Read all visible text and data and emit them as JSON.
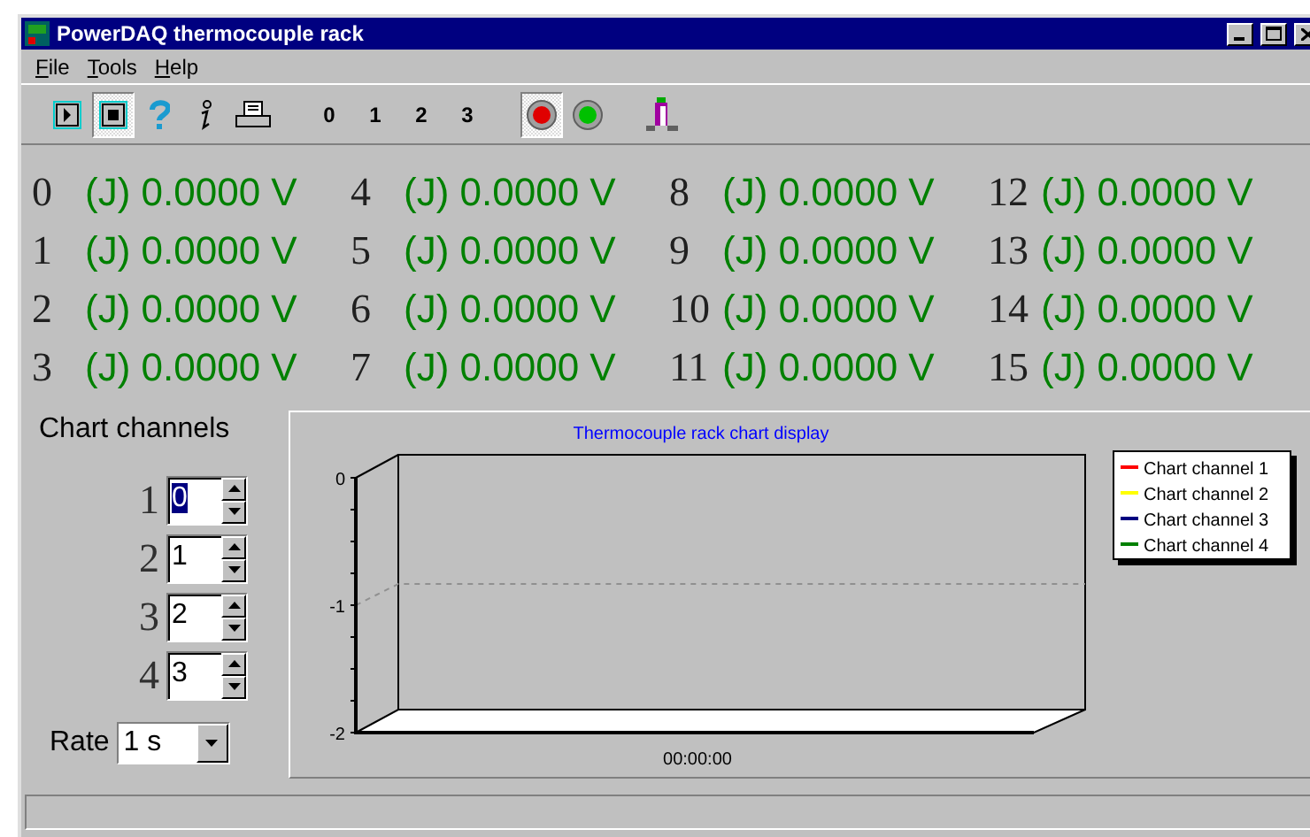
{
  "window": {
    "title": "PowerDAQ thermocouple rack"
  },
  "menu": [
    {
      "label": "File"
    },
    {
      "label": "Tools"
    },
    {
      "label": "Help"
    }
  ],
  "toolbar": [
    {
      "kind": "play",
      "pressed": false
    },
    {
      "kind": "stop",
      "pressed": true
    },
    {
      "kind": "help",
      "pressed": false
    },
    {
      "kind": "info",
      "pressed": false
    },
    {
      "kind": "print",
      "pressed": false
    },
    {
      "kind": "digit",
      "label": "0",
      "pressed": false
    },
    {
      "kind": "digit",
      "label": "1",
      "pressed": false
    },
    {
      "kind": "digit",
      "label": "2",
      "pressed": false
    },
    {
      "kind": "digit",
      "label": "3",
      "pressed": false
    },
    {
      "kind": "led",
      "color": "#e00000",
      "pressed": true
    },
    {
      "kind": "led",
      "color": "#00c000",
      "pressed": false
    },
    {
      "kind": "meter",
      "pressed": false
    }
  ],
  "channels": [
    {
      "number": "0",
      "reading": "(J) 0.0000 V"
    },
    {
      "number": "1",
      "reading": "(J) 0.0000 V"
    },
    {
      "number": "2",
      "reading": "(J) 0.0000 V"
    },
    {
      "number": "3",
      "reading": "(J) 0.0000 V"
    },
    {
      "number": "4",
      "reading": "(J) 0.0000 V"
    },
    {
      "number": "5",
      "reading": "(J) 0.0000 V"
    },
    {
      "number": "6",
      "reading": "(J) 0.0000 V"
    },
    {
      "number": "7",
      "reading": "(J) 0.0000 V"
    },
    {
      "number": "8",
      "reading": "(J) 0.0000 V"
    },
    {
      "number": "9",
      "reading": "(J) 0.0000 V"
    },
    {
      "number": "10",
      "reading": "(J) 0.0000 V"
    },
    {
      "number": "11",
      "reading": "(J) 0.0000 V"
    },
    {
      "number": "12",
      "reading": "(J) 0.0000 V"
    },
    {
      "number": "13",
      "reading": "(J) 0.0000 V"
    },
    {
      "number": "14",
      "reading": "(J) 0.0000 V"
    },
    {
      "number": "15",
      "reading": "(J) 0.0000 V"
    }
  ],
  "chart_channels": {
    "title": "Chart channels",
    "spinners": [
      {
        "label": "1",
        "value": "0",
        "focused": true
      },
      {
        "label": "2",
        "value": "1",
        "focused": false
      },
      {
        "label": "3",
        "value": "2",
        "focused": false
      },
      {
        "label": "4",
        "value": "3",
        "focused": false
      }
    ]
  },
  "rate": {
    "label": "Rate",
    "value": "1 s"
  },
  "chart": {
    "chart_data": {
      "type": "line",
      "title": "Thermocouple rack chart display",
      "ylim": [
        -2,
        0
      ],
      "yticks": [
        0,
        -1,
        -2
      ],
      "categories": [
        "00:00:00"
      ],
      "series": [
        {
          "name": "Chart channel 1",
          "color": "#ff0000",
          "values": [
            null
          ]
        },
        {
          "name": "Chart channel 2",
          "color": "#ffff00",
          "values": [
            null
          ]
        },
        {
          "name": "Chart channel 3",
          "color": "#000080",
          "values": [
            null
          ]
        },
        {
          "name": "Chart channel 4",
          "color": "#008000",
          "values": [
            null
          ]
        }
      ]
    }
  }
}
